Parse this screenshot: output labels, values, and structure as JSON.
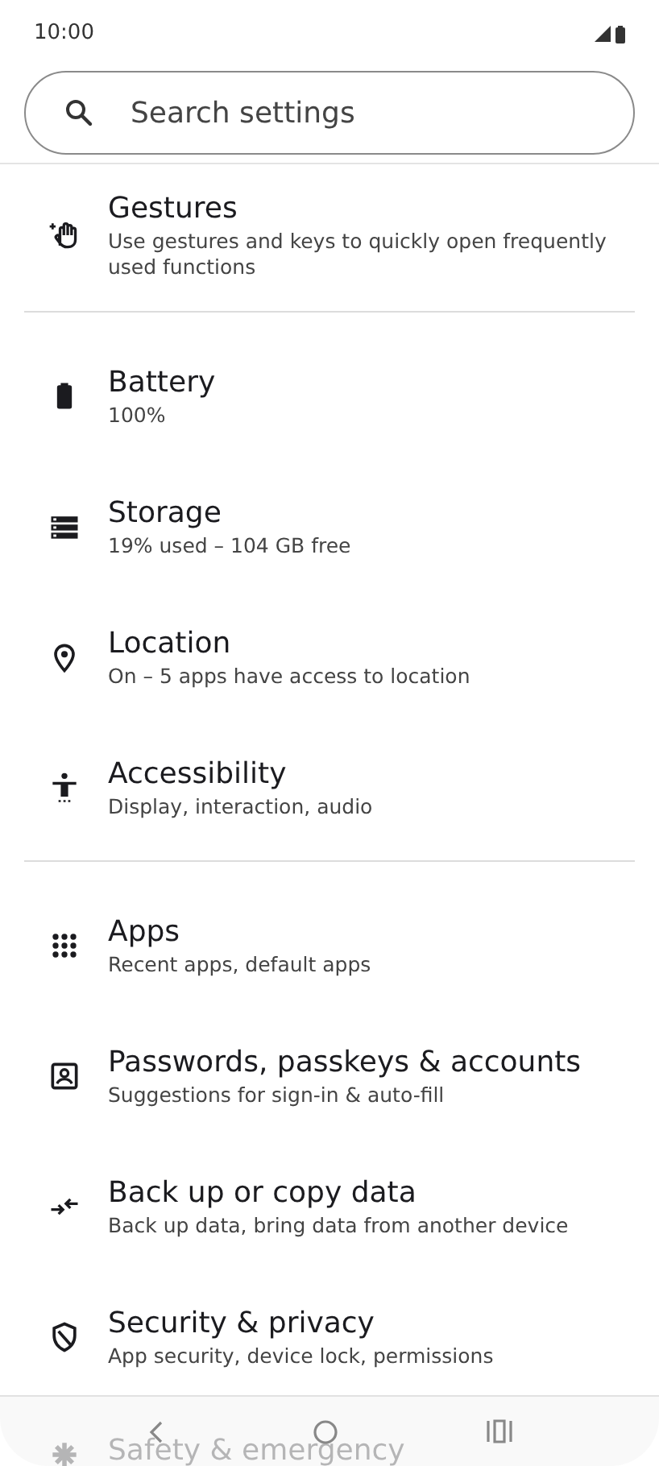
{
  "status_bar": {
    "time": "10:00"
  },
  "search": {
    "placeholder": "Search settings"
  },
  "sections": [
    {
      "items": [
        {
          "title": "Gestures",
          "subtitle": "Use gestures and keys to quickly open frequently used functions"
        }
      ]
    },
    {
      "items": [
        {
          "title": "Battery",
          "subtitle": "100%"
        },
        {
          "title": "Storage",
          "subtitle": "19% used – 104 GB free"
        },
        {
          "title": "Location",
          "subtitle": "On – 5 apps have access to location"
        },
        {
          "title": "Accessibility",
          "subtitle": "Display, interaction, audio"
        }
      ]
    },
    {
      "items": [
        {
          "title": "Apps",
          "subtitle": "Recent apps, default apps"
        },
        {
          "title": "Passwords, passkeys & accounts",
          "subtitle": "Suggestions for sign-in & auto-fill"
        },
        {
          "title": "Back up or copy data",
          "subtitle": "Back up data, bring data from another device"
        },
        {
          "title": "Security & privacy",
          "subtitle": "App security, device lock, permissions"
        },
        {
          "title": "Safety & emergency"
        }
      ]
    }
  ]
}
